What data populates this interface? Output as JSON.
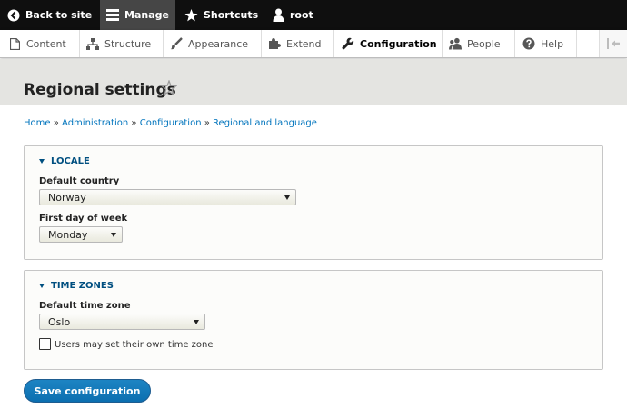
{
  "toolbar": {
    "back_label": "Back to site",
    "manage_label": "Manage",
    "shortcuts_label": "Shortcuts",
    "user_label": "root"
  },
  "tray": {
    "items": [
      {
        "label": "Content",
        "icon": "file-icon"
      },
      {
        "label": "Structure",
        "icon": "sitemap-icon"
      },
      {
        "label": "Appearance",
        "icon": "paintbrush-icon"
      },
      {
        "label": "Extend",
        "icon": "puzzle-icon"
      },
      {
        "label": "Configuration",
        "icon": "wrench-icon"
      },
      {
        "label": "People",
        "icon": "people-icon"
      },
      {
        "label": "Help",
        "icon": "help-icon"
      }
    ],
    "active": "Configuration"
  },
  "page": {
    "title": "Regional settings"
  },
  "breadcrumb": [
    "Home",
    "Administration",
    "Configuration",
    "Regional and language"
  ],
  "locale": {
    "legend": "LOCALE",
    "country_label": "Default country",
    "country_value": "Norway",
    "week_label": "First day of week",
    "week_value": "Monday"
  },
  "timezones": {
    "legend": "TIME ZONES",
    "tz_label": "Default time zone",
    "tz_value": "Oslo",
    "user_tz_label": "Users may set their own time zone",
    "user_tz_checked": false
  },
  "actions": {
    "save_label": "Save configuration"
  }
}
